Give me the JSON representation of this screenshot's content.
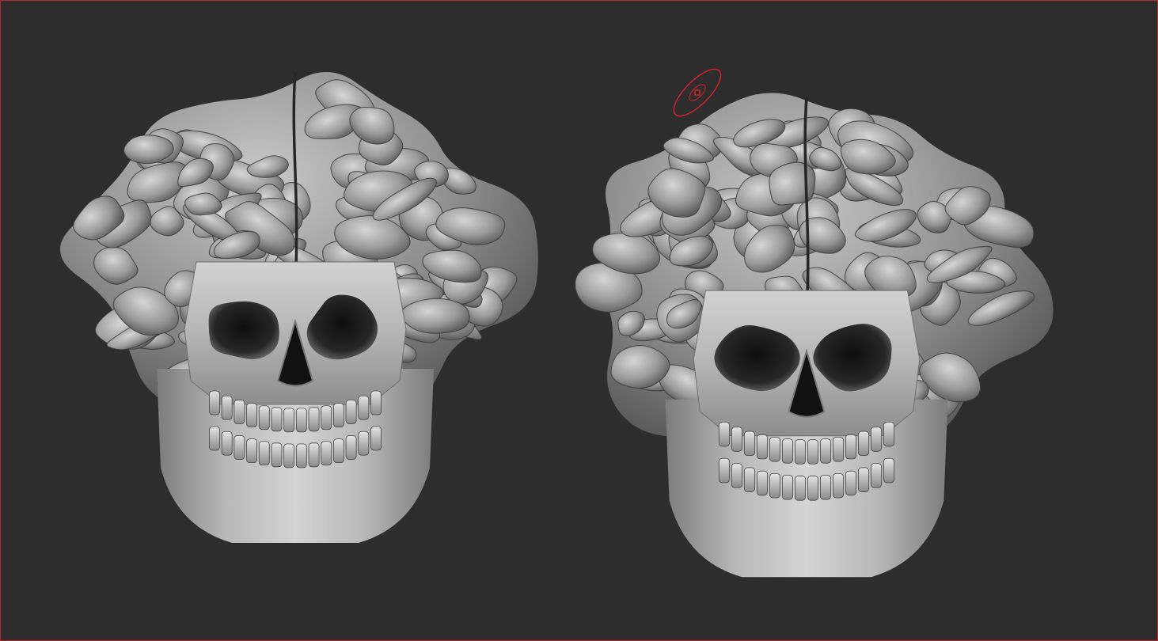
{
  "canvas": {
    "background": "#2d2d2d",
    "frame_color": "#b3262a"
  },
  "models": [
    {
      "id": "model-left",
      "subject": "brain-skull-sculpt",
      "view": "front"
    },
    {
      "id": "model-right",
      "subject": "brain-skull-sculpt",
      "view": "front"
    }
  ],
  "brush_cursor": {
    "icon": "sculpt-brush-cursor-icon",
    "color": "#e0202a"
  }
}
